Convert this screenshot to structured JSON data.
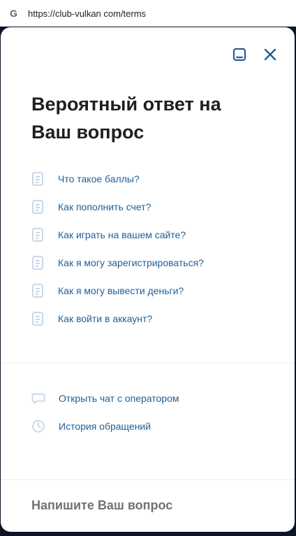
{
  "browser": {
    "url": "https://club-vulkan com/terms",
    "favicon_letter": "G"
  },
  "panel": {
    "heading": "Вероятный ответ на Ваш вопрос",
    "faq": [
      {
        "label": "Что такое баллы?"
      },
      {
        "label": "Как пополнить счет?"
      },
      {
        "label": "Как играть на вашем сайте?"
      },
      {
        "label": "Как я могу зарегистрироваться?"
      },
      {
        "label": "Как я могу вывести деньги?"
      },
      {
        "label": "Как войти в аккаунт?"
      }
    ],
    "actions": {
      "chat": "Открыть чат с оператором",
      "history": "История обращений"
    },
    "input_placeholder": "Напишите Ваш вопрос"
  },
  "colors": {
    "accent": "#1f5f97",
    "icon_light": "#c9d8e6",
    "page_background": "#0b1526"
  }
}
